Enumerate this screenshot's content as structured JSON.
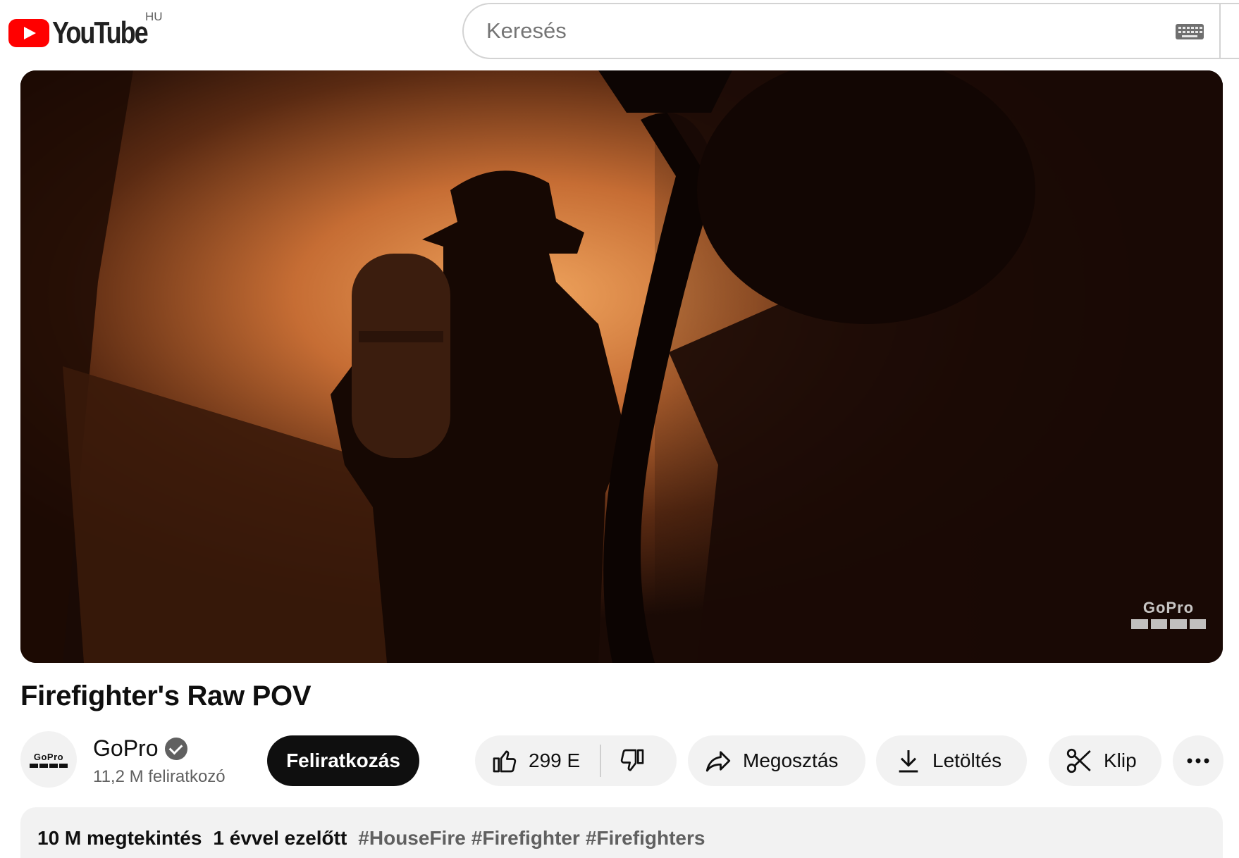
{
  "header": {
    "logo_text": "YouTube",
    "country_code": "HU",
    "search_placeholder": "Keresés"
  },
  "video": {
    "title": "Firefighter's Raw POV",
    "watermark": "GoPro"
  },
  "channel": {
    "name": "GoPro",
    "avatar_text": "GoPro",
    "subscribers": "11,2 M feliratkozó",
    "subscribe_label": "Feliratkozás"
  },
  "actions": {
    "likes": "299 E",
    "share_label": "Megosztás",
    "download_label": "Letöltés",
    "clip_label": "Klip"
  },
  "description": {
    "views": "10 M megtekintés",
    "date": "1 évvel ezelőtt",
    "tags": [
      "#HouseFire",
      "#Firefighter",
      "#Firefighters"
    ]
  },
  "colors": {
    "brand_red": "#ff0000",
    "subscribe_bg": "#0f0f0f",
    "pill_bg": "#f2f2f2"
  }
}
